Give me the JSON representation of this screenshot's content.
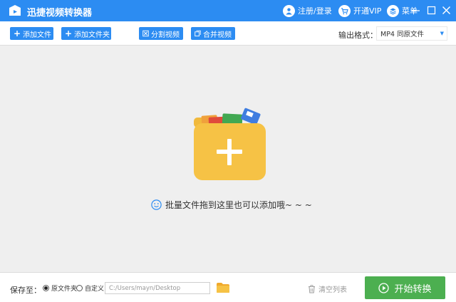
{
  "app": {
    "title": "迅捷视频转换器",
    "accent_color": "#2c8cf2",
    "start_color": "#4caf50",
    "folder_color": "#f6c245"
  },
  "titlebar": {
    "login_label": "注册/登录",
    "login_icon": "user-icon",
    "vip_label": "开通VIP",
    "vip_icon": "cart-icon",
    "menu_label": "菜单",
    "menu_icon": "menu-icon",
    "window_controls": [
      "minimize-icon",
      "maximize-icon",
      "close-icon"
    ]
  },
  "toolbar": {
    "add_file_label": "添加文件",
    "add_folder_label": "添加文件夹",
    "split_label": "分割视频",
    "merge_label": "合并视频",
    "format_label": "输出格式：",
    "format_value": "MP4  同原文件"
  },
  "dropzone": {
    "hint": "批量文件拖到这里也可以添加哦~ ~ ~",
    "hint_icon": "smiley-icon",
    "center_icon": "add-folder-icon"
  },
  "bottom": {
    "save_label": "保存至：",
    "radio_original": "原文件夹",
    "radio_custom": "自定义",
    "selected_option": "原文件夹",
    "path_value": "C:/Users/mayn/Desktop",
    "browse_icon": "folder-icon",
    "clear_label": "清空列表",
    "clear_icon": "trash-icon",
    "start_label": "开始转换",
    "start_icon": "play-circle-icon"
  }
}
